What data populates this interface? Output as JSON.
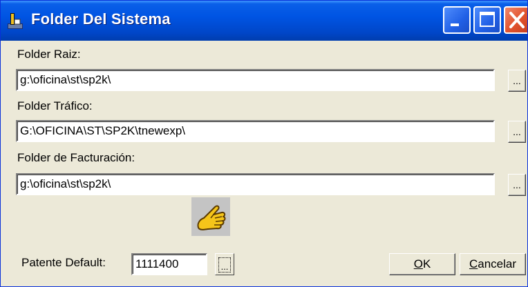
{
  "window": {
    "title": "Folder Del Sistema",
    "buttons": {
      "minimize": "minimize-icon",
      "maximize": "maximize-icon",
      "close": "close-icon"
    }
  },
  "fields": {
    "root": {
      "label": "Folder Raiz:",
      "value": "g:\\oficina\\st\\sp2k\\",
      "browse_label": "..."
    },
    "traffic": {
      "label": "Folder Tráfico:",
      "value": "G:\\OFICINA\\ST\\SP2K\\tnewexp\\",
      "browse_label": "..."
    },
    "billing": {
      "label": "Folder de Facturación:",
      "value": "g:\\oficina\\st\\sp2k\\",
      "browse_label": "..."
    }
  },
  "patent": {
    "label": "Patente Default:",
    "value": "1111400",
    "button_label": "..."
  },
  "actions": {
    "ok": {
      "accel": "O",
      "rest": "K"
    },
    "cancel": {
      "accel": "C",
      "rest": "ancelar"
    }
  },
  "icons": {
    "app": "folder-app-icon",
    "pointer": "pointing-hand-icon"
  }
}
